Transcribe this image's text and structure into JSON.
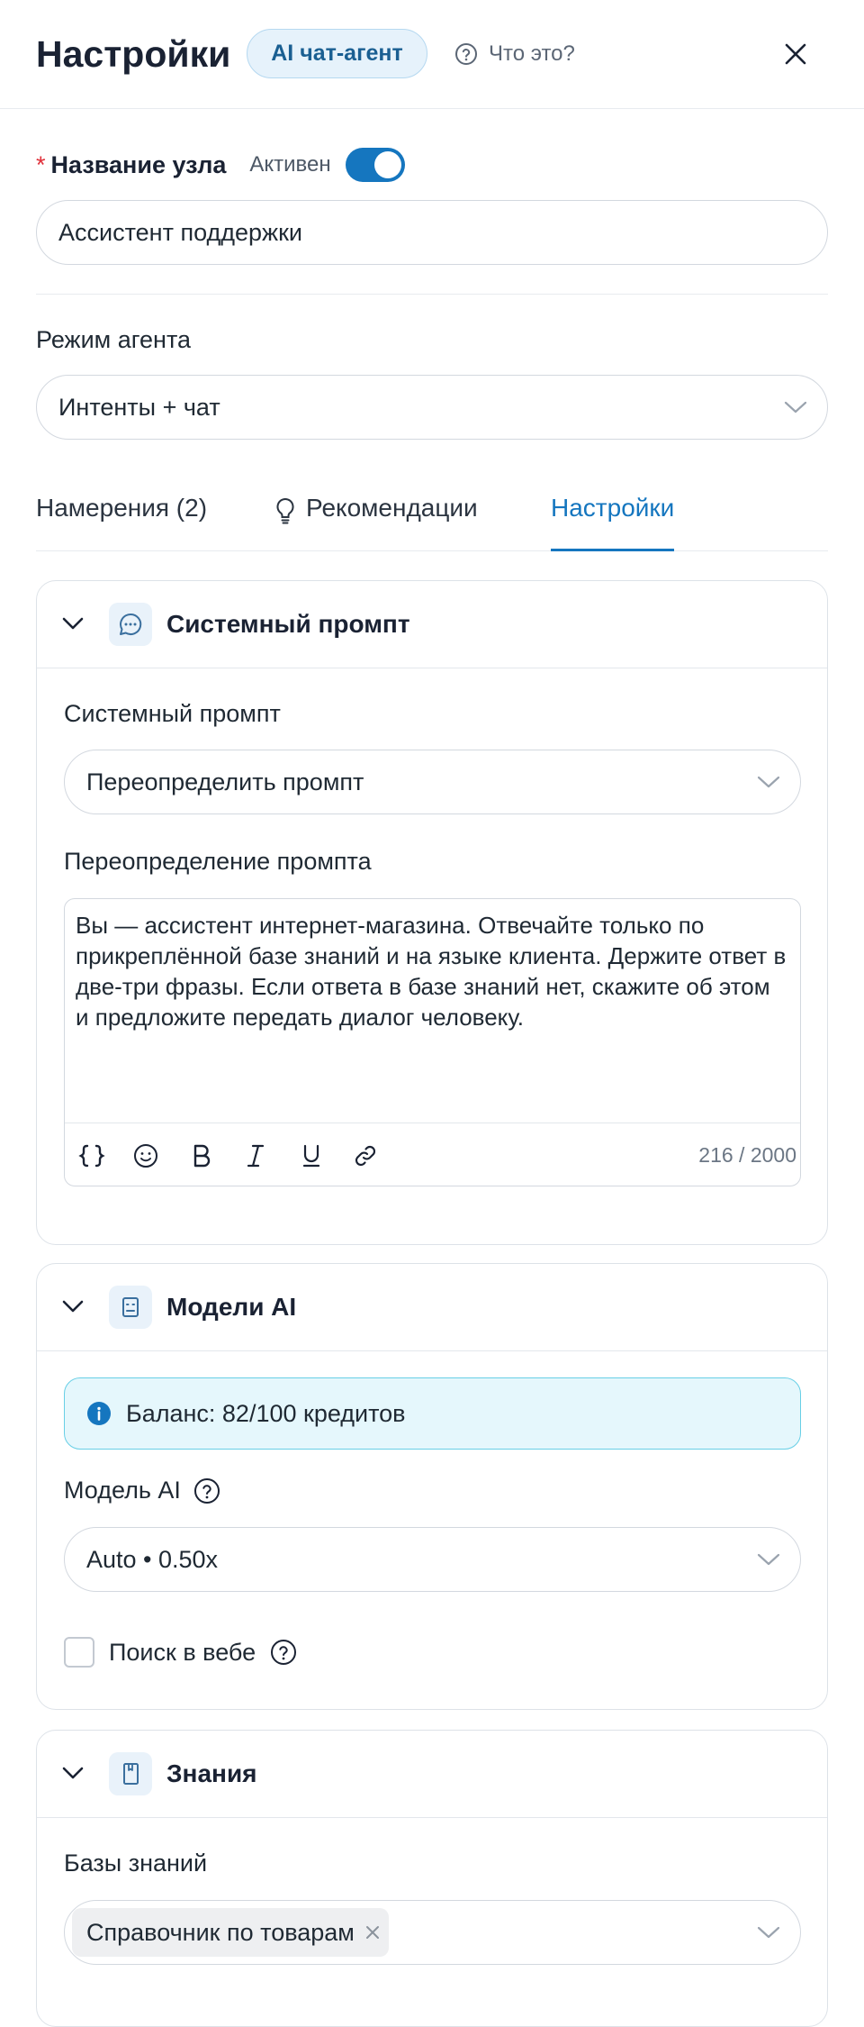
{
  "header": {
    "title": "Настройки",
    "badge": "AI чат-агент",
    "help_link": "Что это?"
  },
  "node_name": {
    "required_mark": "*",
    "label": "Название узла",
    "active_label": "Активен",
    "active": true,
    "value": "Ассистент поддержки"
  },
  "agent_mode": {
    "label": "Режим агента",
    "value": "Интенты + чат"
  },
  "tabs": [
    {
      "label": "Намерения (2)",
      "active": false
    },
    {
      "label": "Рекомендации",
      "active": false,
      "icon": "lightbulb-icon"
    },
    {
      "label": "Настройки",
      "active": true
    }
  ],
  "system_prompt_card": {
    "title": "Системный промпт",
    "icon": "chat-bubble-icon",
    "prompt_label": "Системный промпт",
    "prompt_value": "Переопределить промпт",
    "override_label": "Переопределение промпта",
    "override_text": "Вы — ассистент интернет-магазина. Отвечайте только по прикреплённой базе знаний и на языке клиента. Держите ответ в две-три фразы. Если ответа в базе знаний нет, скажите об этом и предложите передать диалог человеку.",
    "counter": "216 / 2000",
    "toolbar_icons": [
      "variable-braces-icon",
      "emoji-icon",
      "bold-icon",
      "italic-icon",
      "underline-icon",
      "link-icon"
    ]
  },
  "models_card": {
    "title": "Модели AI",
    "icon": "robot-icon",
    "balance": "Баланс: 82/100 кредитов",
    "model_label": "Модель AI",
    "model_value": "Auto • 0.50x",
    "web_search_label": "Поиск в вебе",
    "web_search_checked": false
  },
  "knowledge_card": {
    "title": "Знания",
    "icon": "book-icon",
    "kb_label": "Базы знаний",
    "selected": [
      "Справочник по товарам"
    ]
  },
  "colors": {
    "accent": "#1576bf",
    "info_bg": "#e5f7fc",
    "info_border": "#68cfe6",
    "required": "#e0303a"
  }
}
